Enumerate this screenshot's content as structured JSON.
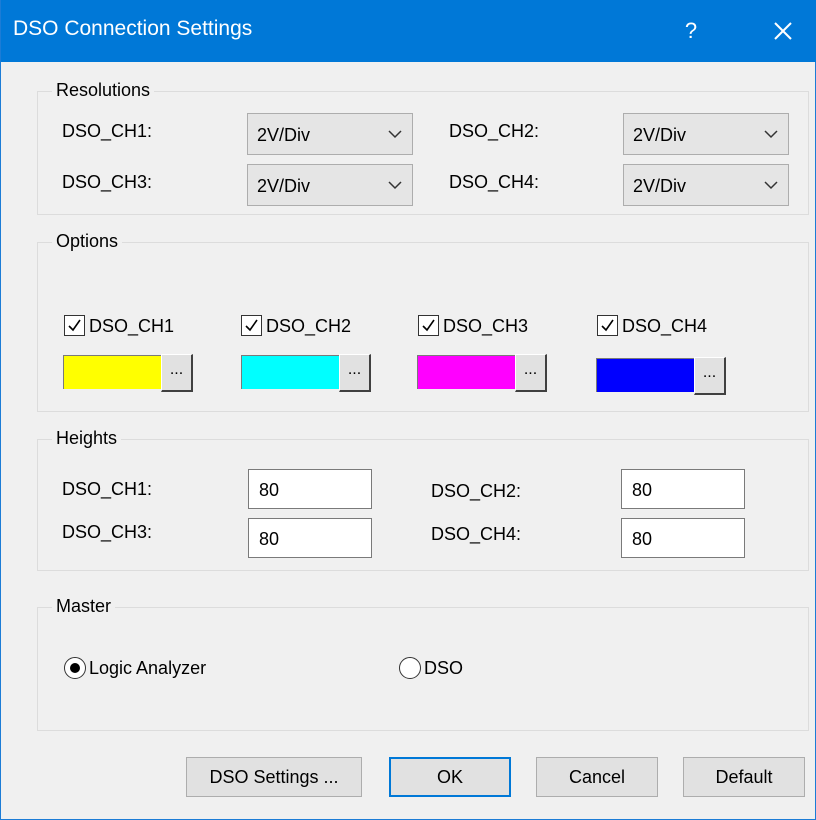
{
  "window": {
    "title": "DSO Connection Settings",
    "help_label": "?"
  },
  "resolutions": {
    "legend": "Resolutions",
    "items": [
      {
        "label": "DSO_CH1:",
        "value": "2V/Div"
      },
      {
        "label": "DSO_CH2:",
        "value": "2V/Div"
      },
      {
        "label": "DSO_CH3:",
        "value": "2V/Div"
      },
      {
        "label": "DSO_CH4:",
        "value": "2V/Div"
      }
    ]
  },
  "options": {
    "legend": "Options",
    "channels": [
      {
        "label": "DSO_CH1",
        "checked": true,
        "color": "#ffff00",
        "button_label": "..."
      },
      {
        "label": "DSO_CH2",
        "checked": true,
        "color": "#00ffff",
        "button_label": "..."
      },
      {
        "label": "DSO_CH3",
        "checked": true,
        "color": "#ff00ff",
        "button_label": "..."
      },
      {
        "label": "DSO_CH4",
        "checked": true,
        "color": "#0000ff",
        "button_label": "..."
      }
    ]
  },
  "heights": {
    "legend": "Heights",
    "items": [
      {
        "label": "DSO_CH1:",
        "value": "80"
      },
      {
        "label": "DSO_CH2:",
        "value": "80"
      },
      {
        "label": "DSO_CH3:",
        "value": "80"
      },
      {
        "label": "DSO_CH4:",
        "value": "80"
      }
    ]
  },
  "master": {
    "legend": "Master",
    "options": [
      {
        "label": "Logic Analyzer",
        "selected": true
      },
      {
        "label": "DSO",
        "selected": false
      }
    ]
  },
  "buttons": {
    "dso_settings": "DSO Settings ...",
    "ok": "OK",
    "cancel": "Cancel",
    "default": "Default"
  },
  "colors": {
    "accent": "#0078d7",
    "dialog_bg": "#f0f0f0"
  }
}
